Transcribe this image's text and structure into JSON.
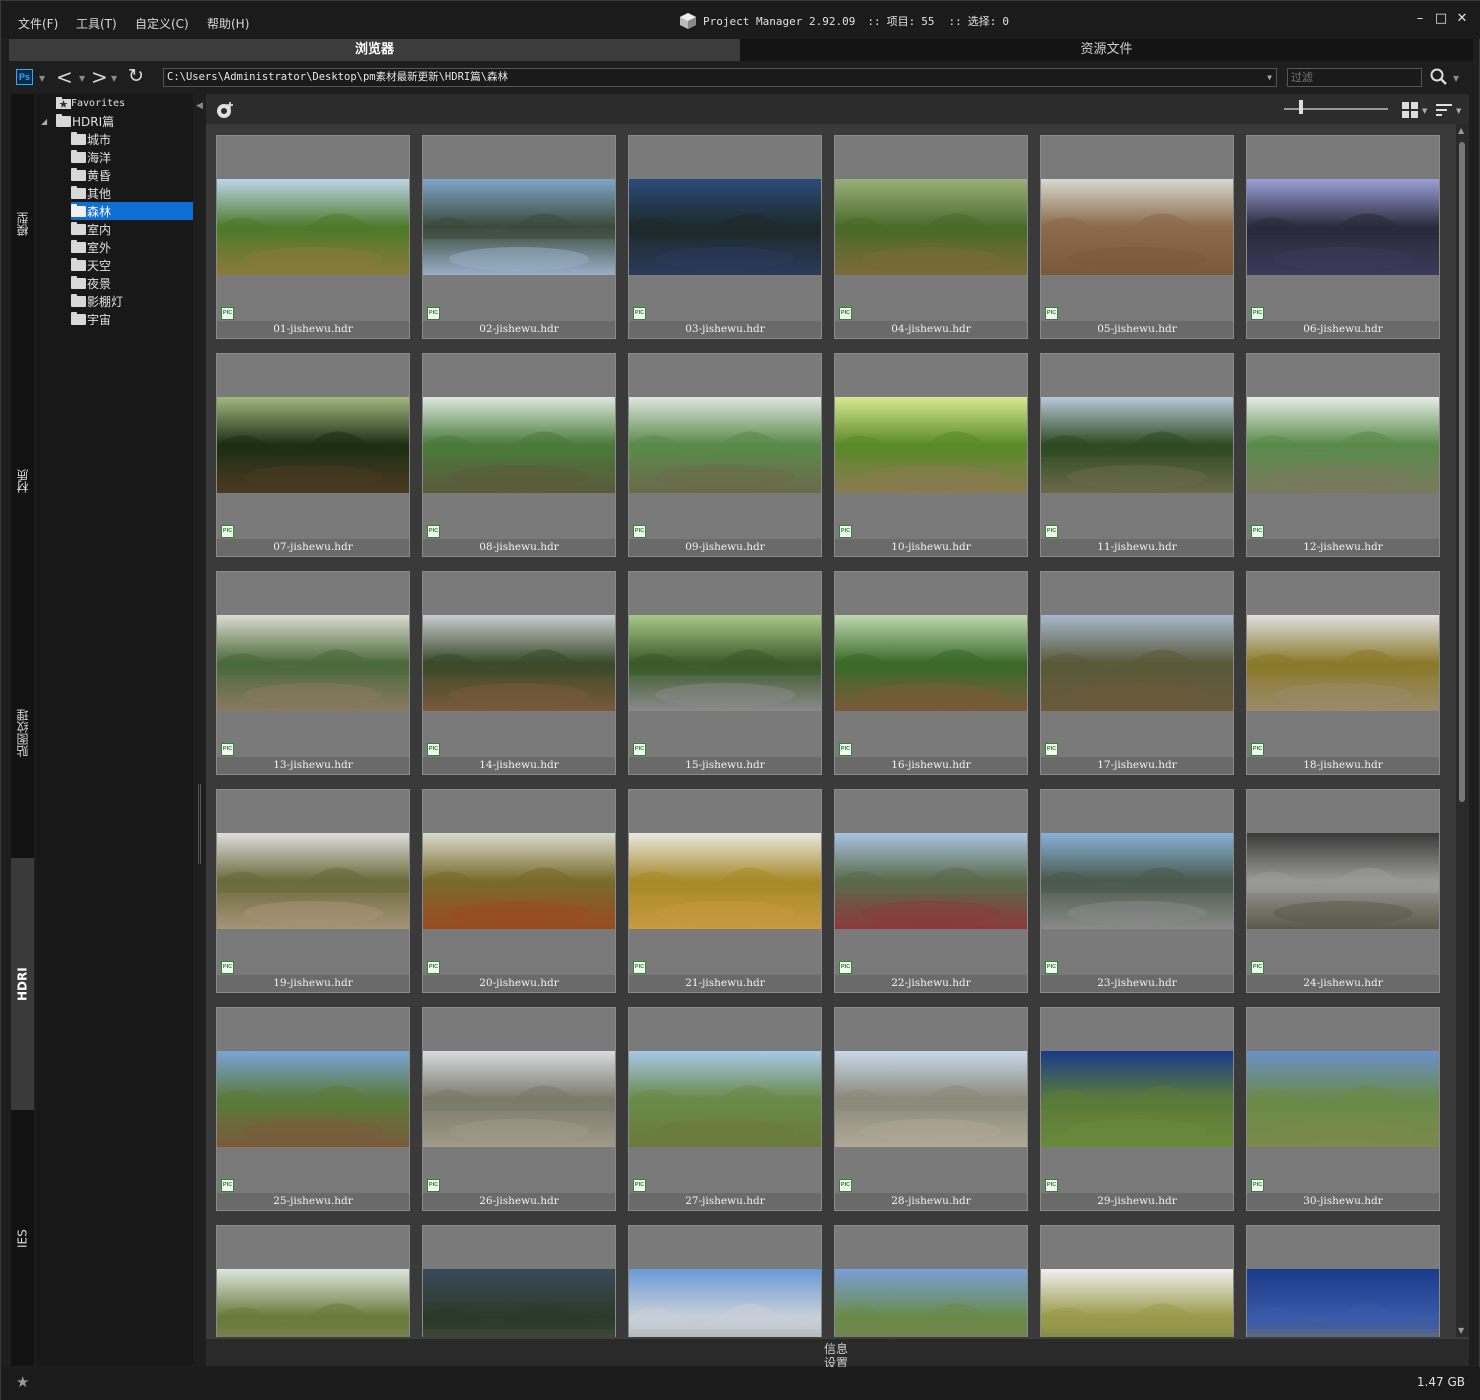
{
  "menu": [
    "文件(F)",
    "工具(T)",
    "自定义(C)",
    "帮助(H)"
  ],
  "title": {
    "app": "Project Manager 2.92.09",
    "items_label": "项目:",
    "items_count": "55",
    "selection_label": "选择:",
    "selection_count": "0",
    "separator": "::"
  },
  "window_buttons": [
    "–",
    "□",
    "✕"
  ],
  "tabs": {
    "browser": "浏览器",
    "assets": "资源文件"
  },
  "pathbar": {
    "ps_label": "Ps",
    "back": "<",
    "forward": ">",
    "refresh": "↻",
    "path": "C:\\Users\\Administrator\\Desktop\\pm素材最新更新\\HDRI篇\\森林",
    "filter_placeholder": "过滤"
  },
  "categories": [
    "模型",
    "材质",
    "贴图纹理",
    "HDRI",
    "IES"
  ],
  "active_category": "HDRI",
  "tree": {
    "favorites": "Favorites",
    "root": "HDRI篇",
    "children": [
      "城市",
      "海洋",
      "黄昏",
      "其他",
      "森林",
      "室内",
      "室外",
      "天空",
      "夜景",
      "影棚灯",
      "宇宙"
    ],
    "selected": "森林"
  },
  "pic_badge": "PIC",
  "files": [
    "01-jishewu.hdr",
    "02-jishewu.hdr",
    "03-jishewu.hdr",
    "04-jishewu.hdr",
    "05-jishewu.hdr",
    "06-jishewu.hdr",
    "07-jishewu.hdr",
    "08-jishewu.hdr",
    "09-jishewu.hdr",
    "10-jishewu.hdr",
    "11-jishewu.hdr",
    "12-jishewu.hdr",
    "13-jishewu.hdr",
    "14-jishewu.hdr",
    "15-jishewu.hdr",
    "16-jishewu.hdr",
    "17-jishewu.hdr",
    "18-jishewu.hdr",
    "19-jishewu.hdr",
    "20-jishewu.hdr",
    "21-jishewu.hdr",
    "22-jishewu.hdr",
    "23-jishewu.hdr",
    "24-jishewu.hdr",
    "25-jishewu.hdr",
    "26-jishewu.hdr",
    "27-jishewu.hdr",
    "28-jishewu.hdr",
    "29-jishewu.hdr",
    "30-jishewu.hdr",
    "",
    "",
    "",
    "",
    "",
    ""
  ],
  "thumb_colors": [
    [
      "#bcd6e8",
      "#4e7a2a",
      "#8a7a3a"
    ],
    [
      "#7fa6c6",
      "#3a4a3a",
      "#9ab0c8"
    ],
    [
      "#2c4a7a",
      "#1e2a2a",
      "#2a3a5a"
    ],
    [
      "#9ab07a",
      "#4a6a2a",
      "#7a6a3a"
    ],
    [
      "#d8d8d0",
      "#8a6a4a",
      "#7a5a3a"
    ],
    [
      "#9aa0d8",
      "#2a2a3a",
      "#3a3a5a"
    ],
    [
      "#a0b880",
      "#1e2e14",
      "#4a3a22"
    ],
    [
      "#dde8e0",
      "#4a7a3a",
      "#5a5a3a"
    ],
    [
      "#e0e6e0",
      "#5a8a4a",
      "#6a6a4a"
    ],
    [
      "#d8e890",
      "#5a8a2a",
      "#8a7a50"
    ],
    [
      "#b8c8d8",
      "#2e4a22",
      "#6a6a4a"
    ],
    [
      "#e6ece6",
      "#5a8a4a",
      "#7a7a60"
    ],
    [
      "#dcdcd0",
      "#4a6a3a",
      "#8a7a60"
    ],
    [
      "#c8ccd0",
      "#3a4a2a",
      "#7a5a3a"
    ],
    [
      "#a8c888",
      "#3a5a2a",
      "#8a8a8a"
    ],
    [
      "#c0d8b0",
      "#3a6a2a",
      "#7a5a3a"
    ],
    [
      "#a8b8d0",
      "#5a5a3a",
      "#6a5a3a"
    ],
    [
      "#e0e0e0",
      "#8a7a2a",
      "#9a8a6a"
    ],
    [
      "#dedede",
      "#6a6a3a",
      "#a89478"
    ],
    [
      "#d8dccc",
      "#7a6a2a",
      "#9a4a22"
    ],
    [
      "#e8e8e0",
      "#a88a2a",
      "#c89a40"
    ],
    [
      "#a8c4e0",
      "#5a6a4a",
      "#8a3a3a"
    ],
    [
      "#88b0d8",
      "#4a5a4a",
      "#8a8a8a"
    ],
    [
      "#3a3a3a",
      "#9a9a98",
      "#5a5a4a"
    ],
    [
      "#7aa4d8",
      "#5a7a3a",
      "#7a5a3a"
    ],
    [
      "#d8dce0",
      "#7a7a6a",
      "#a09a8a"
    ],
    [
      "#a8c8e8",
      "#6a8a4a",
      "#6a7a3a"
    ],
    [
      "#c8d8e8",
      "#8a8a7a",
      "#b0a898"
    ],
    [
      "#1a3a8a",
      "#5a7a3a",
      "#6a8a3a"
    ],
    [
      "#6a90c8",
      "#6a8a4a",
      "#7a8a4a"
    ],
    [
      "#dde6e0",
      "#6a7a3a",
      "#8a8a6a"
    ],
    [
      "#3a4a5a",
      "#2a3a2a",
      "#5a5a4a"
    ],
    [
      "#6a9ad8",
      "#c8d0d8",
      "#9a9a9a"
    ],
    [
      "#7aa0d8",
      "#6a8a4a",
      "#7a7a5a"
    ],
    [
      "#f0f0f0",
      "#9a9a4a",
      "#6a7a4a"
    ],
    [
      "#1a3a8a",
      "#3a5aa8",
      "#8a7a4a"
    ]
  ],
  "info_label": "信息",
  "settings_label": "设置",
  "status": {
    "disk_size": "1.47 GB"
  }
}
